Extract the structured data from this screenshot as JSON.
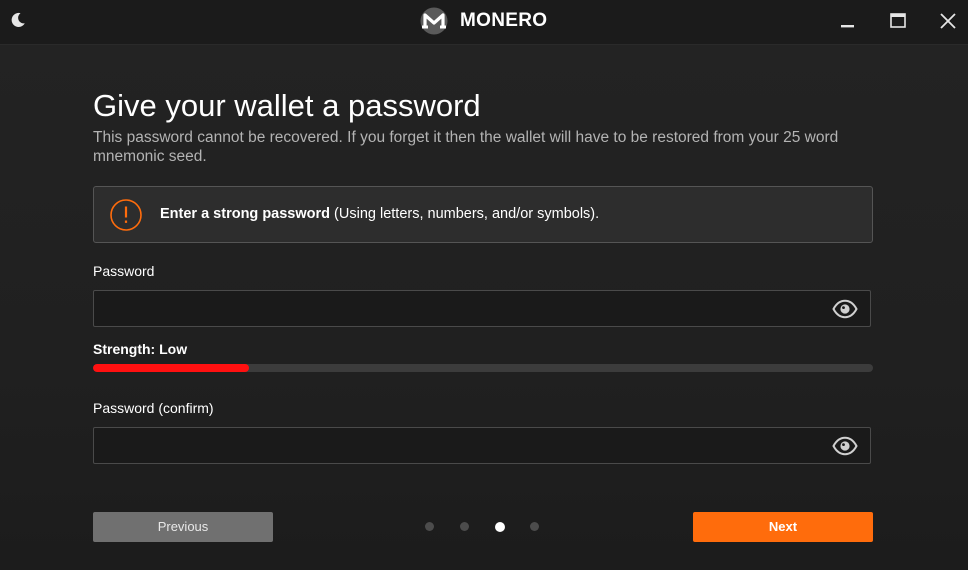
{
  "titlebar": {
    "app_name": "MONERO",
    "icons": [
      "moon-icon",
      "monero-logo",
      "minimize-icon",
      "maximize-icon",
      "close-icon"
    ]
  },
  "page": {
    "title": "Give your wallet a password",
    "subtitle": "This password cannot be recovered. If you forget it then the wallet will have to be restored from your 25 word mnemonic seed."
  },
  "warning": {
    "icon": "exclamation-circle-icon",
    "bold": "Enter a strong password",
    "text": " (Using letters, numbers, and/or symbols)."
  },
  "password": {
    "label": "Password",
    "value": "",
    "icon": "eye-icon"
  },
  "strength": {
    "label": "Strength: Low",
    "level": 0.2
  },
  "confirm": {
    "label": "Password (confirm)",
    "value": "",
    "icon": "eye-icon"
  },
  "nav": {
    "previous_label": "Previous",
    "next_label": "Next",
    "steps_total": 4,
    "steps_current": 3
  },
  "colors": {
    "accent": "#ff6c0c",
    "strength_low": "#ff1010",
    "warning_icon": "#ff6c0c"
  }
}
